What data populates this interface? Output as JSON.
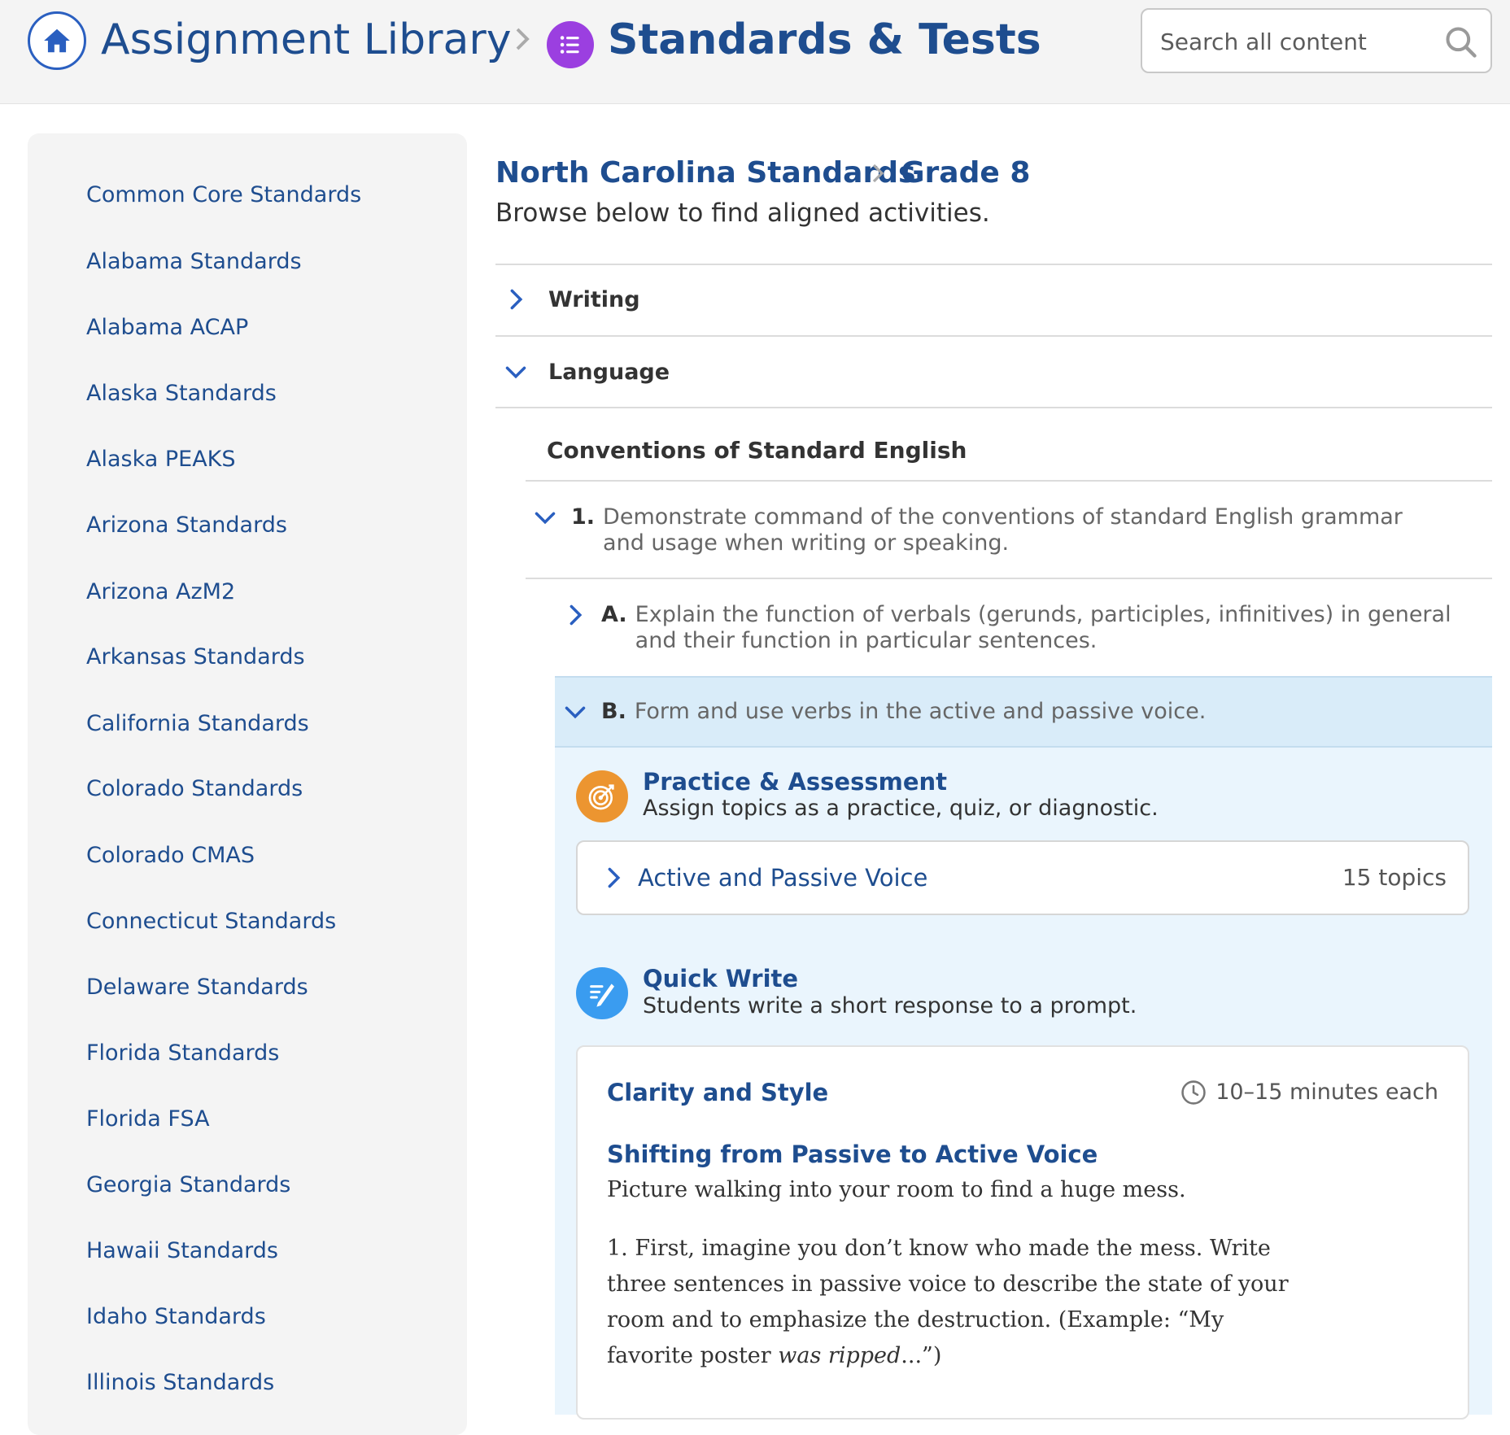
{
  "header": {
    "library_title": "Assignment Library",
    "section_title": "Standards & Tests",
    "search_placeholder": "Search all content"
  },
  "sidebar": {
    "items": [
      {
        "label": "Common Core Standards"
      },
      {
        "label": "Alabama Standards"
      },
      {
        "label": "Alabama ACAP"
      },
      {
        "label": "Alaska Standards"
      },
      {
        "label": "Alaska PEAKS"
      },
      {
        "label": "Arizona Standards"
      },
      {
        "label": "Arizona AzM2"
      },
      {
        "label": "Arkansas Standards"
      },
      {
        "label": "California Standards"
      },
      {
        "label": "Colorado Standards"
      },
      {
        "label": "Colorado CMAS"
      },
      {
        "label": "Connecticut Standards"
      },
      {
        "label": "Delaware Standards"
      },
      {
        "label": "Florida Standards"
      },
      {
        "label": "Florida FSA"
      },
      {
        "label": "Georgia Standards"
      },
      {
        "label": "Hawaii Standards"
      },
      {
        "label": "Idaho Standards"
      },
      {
        "label": "Illinois Standards"
      }
    ]
  },
  "main": {
    "breadcrumb": {
      "state": "North Carolina Standards",
      "grade": "Grade 8"
    },
    "subtitle": "Browse below to find aligned activities.",
    "sections": {
      "writing": "Writing",
      "language": "Language"
    },
    "strand": "Conventions of Standard English",
    "standard_1": {
      "num": "1.",
      "text": "Demonstrate command of the conventions of standard English grammar and usage when writing or speaking."
    },
    "standard_a": {
      "num": "A.",
      "text": "Explain the function of verbals (gerunds, participles, infinitives) in general and their function in particular sentences."
    },
    "standard_b": {
      "num": "B.",
      "text": "Form and use verbs in the active and passive voice."
    },
    "practice": {
      "title": "Practice & Assessment",
      "desc": "Assign topics as a practice, quiz, or diagnostic.",
      "topic_name": "Active and Passive Voice",
      "topic_count": "15 topics"
    },
    "quick_write": {
      "title": "Quick Write",
      "desc": "Students write a short response to a prompt.",
      "card_title": "Clarity and Style",
      "time": "10–15 minutes each",
      "prompt_title": "Shifting from Passive to Active Voice",
      "prompt_intro": "Picture walking into your room to find a huge mess.",
      "prompt_step_1": "1. First, imagine you don’t know who made the mess. Write three sentences in passive voice to describe the state of your room and to emphasize the destruction. (Example: “My favorite poster ",
      "prompt_step_1_italic": "was ripped",
      "prompt_step_1_end": "...”)"
    }
  },
  "colors": {
    "brand_blue": "#1e4d8f",
    "link_blue": "#2a5fc0",
    "standards_purple": "#9b3fe0",
    "practice_orange": "#ec9530",
    "quickwrite_blue": "#3a9cf0",
    "selected_band": "#d9ecf9",
    "panel_bg": "#eaf5fd"
  },
  "icons": {
    "home": "home-icon",
    "standards": "list-icon",
    "search": "search-icon",
    "practice": "target-icon",
    "quick_write": "pencil-lines-icon",
    "time": "clock-icon"
  }
}
